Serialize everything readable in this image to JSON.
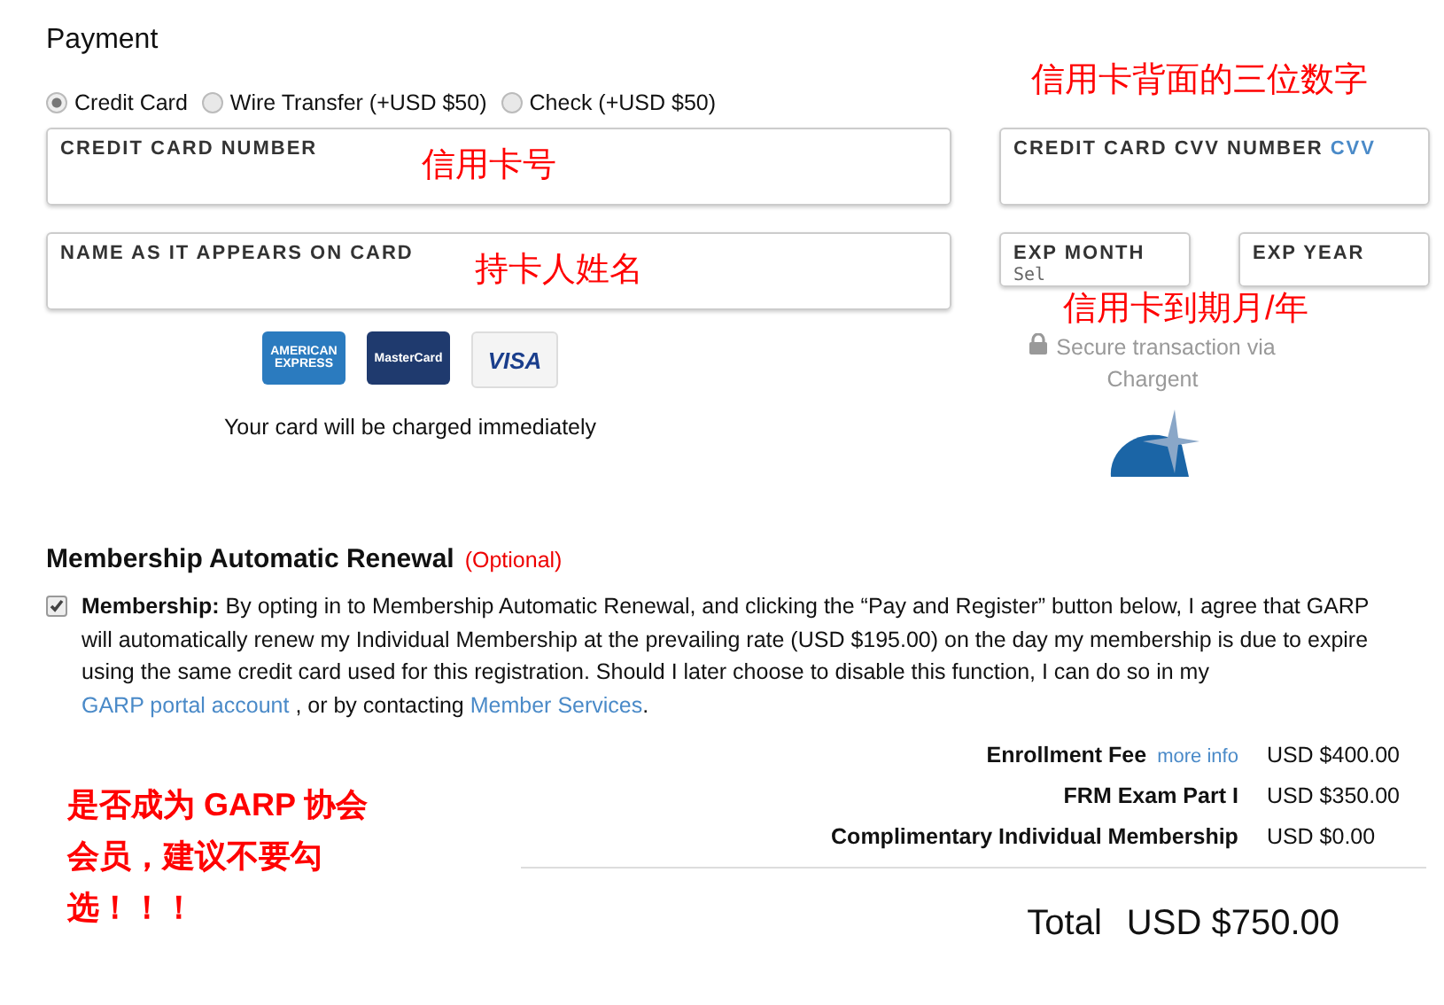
{
  "title": "Payment",
  "methods": [
    {
      "label": "Credit Card",
      "selected": true
    },
    {
      "label": "Wire Transfer (+USD $50)",
      "selected": false
    },
    {
      "label": "Check (+USD $50)",
      "selected": false
    }
  ],
  "card_number": {
    "label": "CREDIT CARD NUMBER"
  },
  "cvv": {
    "label": "CREDIT CARD CVV NUMBER",
    "link": "CVV"
  },
  "name": {
    "label": "NAME AS IT APPEARS ON CARD"
  },
  "exp_month": {
    "label": "EXP MONTH",
    "placeholder": "Sel"
  },
  "exp_year": {
    "label": "EXP YEAR"
  },
  "cards": [
    {
      "kind": "amex",
      "label": "AMERICAN EXPRESS"
    },
    {
      "kind": "mastercard",
      "label": "MasterCard"
    },
    {
      "kind": "visa",
      "label": "VISA"
    }
  ],
  "charge_note": "Your card will be charged immediately",
  "secure_note": "Secure transaction via Chargent",
  "renewal": {
    "title": "Membership Automatic Renewal",
    "optional": "(Optional)",
    "checked": true,
    "lead": "Membership:",
    "text": "By opting in to Membership Automatic Renewal, and clicking the “Pay and Register” button below, I agree that GARP will automatically renew my Individual Membership at the prevailing rate (USD $195.00) on the day my membership is due to expire using the same credit card used for this registration. Should I later choose to disable this function, I can do so in my",
    "link1": "GARP portal account",
    "mid": ", or by contacting",
    "link2": "Member Services",
    "end": "."
  },
  "fees": [
    {
      "label": "Enrollment Fee",
      "info": "more info",
      "amount": "USD $400.00"
    },
    {
      "label": "FRM Exam Part I",
      "amount": "USD $350.00"
    },
    {
      "label": "Complimentary Individual Membership",
      "amount": "USD $0.00"
    }
  ],
  "total": {
    "label": "Total",
    "amount": "USD $750.00"
  },
  "annotations": [
    {
      "kind": "cvv",
      "text": "信用卡背面的三位数字"
    },
    {
      "kind": "number",
      "text": "信用卡号"
    },
    {
      "kind": "name",
      "text": "持卡人姓名"
    },
    {
      "kind": "expiry",
      "text": "信用卡到期月/年"
    },
    {
      "kind": "membership",
      "lines": [
        "是否成为 GARP 协会",
        "会员，建议不要勾",
        "选！！！"
      ]
    }
  ]
}
